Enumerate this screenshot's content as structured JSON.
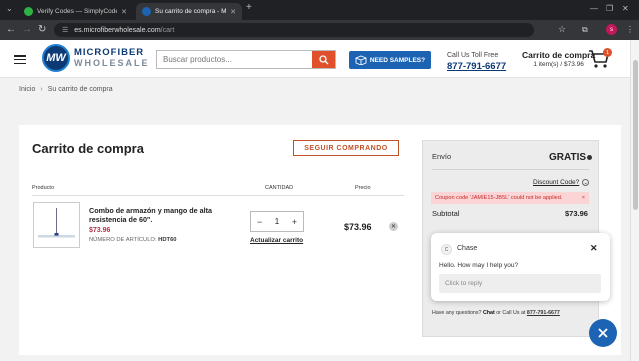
{
  "browser": {
    "tabs": [
      {
        "title": "Verify Codes — SimplyCodes",
        "favicon_color": "#2fb344"
      },
      {
        "title": "Su carrito de compra - Microfib",
        "favicon_color": "#1d63b3"
      }
    ],
    "new_tab": "+",
    "url_host": "es.microfiberwholesale.com",
    "url_path": "/cart",
    "profile_initial": "s"
  },
  "header": {
    "logo_line1": "MICROFIBER",
    "logo_line2": "WHOLESALE",
    "logo_mark": "MW",
    "search_placeholder": "Buscar productos...",
    "samples_label": "NEED SAMPLES?",
    "call_label": "Call Us Toll Free",
    "phone": "877-791-6677",
    "cart_title": "Carrito de compra",
    "cart_summary": "1 item(s) / $73.96",
    "cart_count": "1"
  },
  "breadcrumb": {
    "home": "Inicio",
    "current": "Su carrito de compra",
    "separator": "›"
  },
  "cart": {
    "title": "Carrito de compra",
    "continue_label": "SEGUIR COMPRANDO",
    "columns": {
      "product": "Producto",
      "quantity": "CANTIDAD",
      "price": "Precio"
    },
    "item": {
      "name": "Combo de armazón y mango de alta resistencia de 60\".",
      "price": "$73.96",
      "sku_label": "NÚMERO DE ARTÍCULO:",
      "sku": "HDT60",
      "quantity": "1",
      "minus": "−",
      "plus": "+",
      "update_label": "Actualizar carrito",
      "line_total": "$73.96",
      "remove": "✕"
    }
  },
  "summary": {
    "shipping_label": "Envío",
    "shipping_value": "GRATIS",
    "discount_label": "Discount Code?",
    "error_text": "Coupon code 'JAMIE15-JB5L' could not be applied.",
    "error_close": "×",
    "subtotal_label": "Subtotal",
    "subtotal_value": "$73.96",
    "help_prefix": "Have any questions?",
    "help_chat": "Chat",
    "help_middle": "or Call Us at",
    "help_phone": "877-791-6677"
  },
  "chat": {
    "agent": "Chase",
    "agent_initial": "C",
    "message": "Hello. How may I help you?",
    "reply_placeholder": "Click to reply",
    "close": "✕"
  },
  "colors": {
    "brand_navy": "#0d3a74",
    "accent_orange": "#e0512b",
    "button_blue": "#1d63b3",
    "price_red": "#b5324b",
    "error_bg": "#fbd5d6"
  }
}
